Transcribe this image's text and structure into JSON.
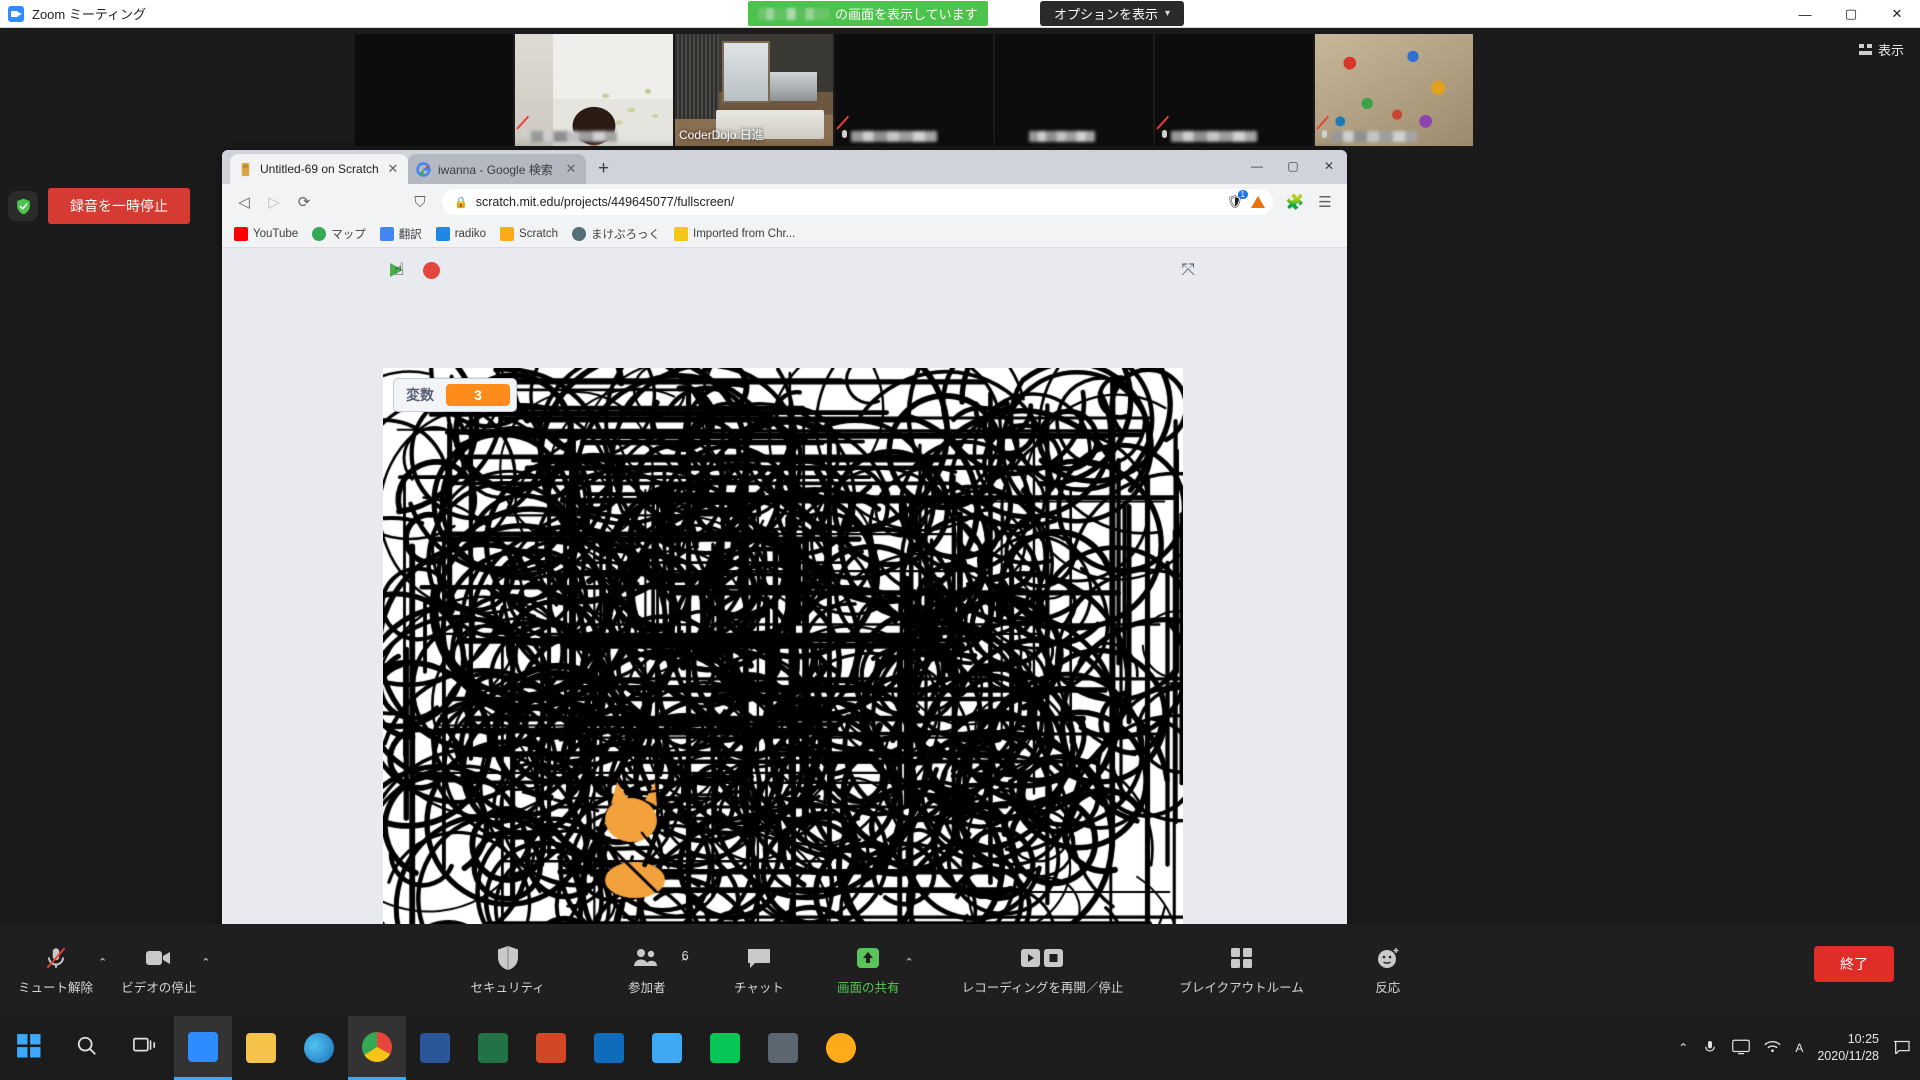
{
  "zoom_window": {
    "title": "Zoom ミーティング",
    "share_banner": {
      "suffix": "の画面を表示しています",
      "name_redacted": true
    },
    "options_button": "オプションを表示",
    "view_button": "表示",
    "window_controls": {
      "minimize": "—",
      "maximize": "▢",
      "close": "✕"
    }
  },
  "recording": {
    "pause_label": "録音を一時停止"
  },
  "thumbnails": [
    {
      "name": "",
      "redacted": true,
      "kind": "dark",
      "muted": false,
      "active": false
    },
    {
      "name": "",
      "redacted": true,
      "kind": "person",
      "muted": true,
      "active": false
    },
    {
      "name": "CoderDojo 日進",
      "redacted": false,
      "kind": "room",
      "muted": false,
      "active": true
    },
    {
      "name": "",
      "redacted": true,
      "kind": "dark",
      "muted": true,
      "active": false
    },
    {
      "name": "",
      "redacted": true,
      "kind": "dark",
      "muted": false,
      "active": false
    },
    {
      "name": "",
      "redacted": true,
      "kind": "dark",
      "muted": true,
      "active": false
    },
    {
      "name": "",
      "redacted": true,
      "kind": "toys",
      "muted": true,
      "active": false
    }
  ],
  "browser": {
    "tabs": [
      {
        "title": "Untitled-69 on Scratch",
        "active": true,
        "favicon": "scratch-favicon"
      },
      {
        "title": "iwanna - Google 検索",
        "active": false,
        "favicon": "google-favicon"
      }
    ],
    "new_tab_label": "+",
    "window_controls": {
      "minimize": "—",
      "maximize": "▢",
      "close": "✕"
    },
    "nav": {
      "back": "◁",
      "forward": "▷",
      "reload": "⟳",
      "bookmark": "⛉"
    },
    "omnibox": {
      "url": "scratch.mit.edu/projects/449645077/fullscreen/",
      "lock": "🔒",
      "extension_badge_count": "1"
    },
    "bookmarks": [
      {
        "label": "YouTube",
        "color": "#ff0000"
      },
      {
        "label": "マップ",
        "color": "#34a853"
      },
      {
        "label": "翻訳",
        "color": "#4285f4"
      },
      {
        "label": "radiko",
        "color": "#1e88e5"
      },
      {
        "label": "Scratch",
        "color": "#ffab19"
      },
      {
        "label": "まけぶろっく",
        "color": "#546e7a"
      },
      {
        "label": "Imported from Chr...",
        "color": "#f5c518"
      }
    ]
  },
  "scratch": {
    "green_flag": "green-flag",
    "stop_button": "stop-sign",
    "unfullscreen": "⤧",
    "variable_monitor": {
      "label": "変数",
      "value": "3"
    }
  },
  "zoom_toolbar": {
    "items": [
      {
        "label": "ミュート解除",
        "icon": "mic-muted-icon",
        "caret": true,
        "green": false
      },
      {
        "label": "ビデオの停止",
        "icon": "video-icon",
        "caret": true,
        "green": false
      },
      {
        "label": "セキュリティ",
        "icon": "shield-icon",
        "caret": false,
        "green": false
      },
      {
        "label": "参加者",
        "icon": "participants-icon",
        "caret": true,
        "green": false,
        "count": "6"
      },
      {
        "label": "チャット",
        "icon": "chat-icon",
        "caret": false,
        "green": false
      },
      {
        "label": "画面の共有",
        "icon": "share-screen-icon",
        "caret": true,
        "green": true
      },
      {
        "label": "レコーディングを再開／停止",
        "icon": "record-icon",
        "caret": false,
        "green": false
      },
      {
        "label": "ブレイクアウトルーム",
        "icon": "breakout-icon",
        "caret": false,
        "green": false
      },
      {
        "label": "反応",
        "icon": "reactions-icon",
        "caret": false,
        "green": false
      }
    ],
    "end_button": "終了"
  },
  "taskbar": {
    "start": "start-icon",
    "search": "search-icon",
    "task_view": "task-view-icon",
    "apps": [
      {
        "name": "zoom",
        "color": "#2d8cff",
        "selected": true
      },
      {
        "name": "file-explorer",
        "color": "#f5c24a",
        "selected": false
      },
      {
        "name": "edge",
        "color": "#2b8ccc",
        "selected": false
      },
      {
        "name": "chrome",
        "color": "#e8453c",
        "selected": true
      },
      {
        "name": "word",
        "color": "#2b579a",
        "selected": false
      },
      {
        "name": "excel",
        "color": "#217346",
        "selected": false
      },
      {
        "name": "powerpoint",
        "color": "#d24726",
        "selected": false
      },
      {
        "name": "outlook",
        "color": "#0f6cbd",
        "selected": false
      },
      {
        "name": "photos",
        "color": "#3fa9f5",
        "selected": false
      },
      {
        "name": "line",
        "color": "#06c755",
        "selected": false
      },
      {
        "name": "calculator",
        "color": "#5c6670",
        "selected": false
      },
      {
        "name": "scratch",
        "color": "#ffab19",
        "selected": false
      }
    ],
    "tray": {
      "chevron": "⌃",
      "mic": "mic-icon",
      "display": "display-icon",
      "network": "network-icon",
      "ime": "A",
      "notification": "notification-icon"
    },
    "clock": {
      "time": "10:25",
      "date": "2020/11/28"
    }
  }
}
